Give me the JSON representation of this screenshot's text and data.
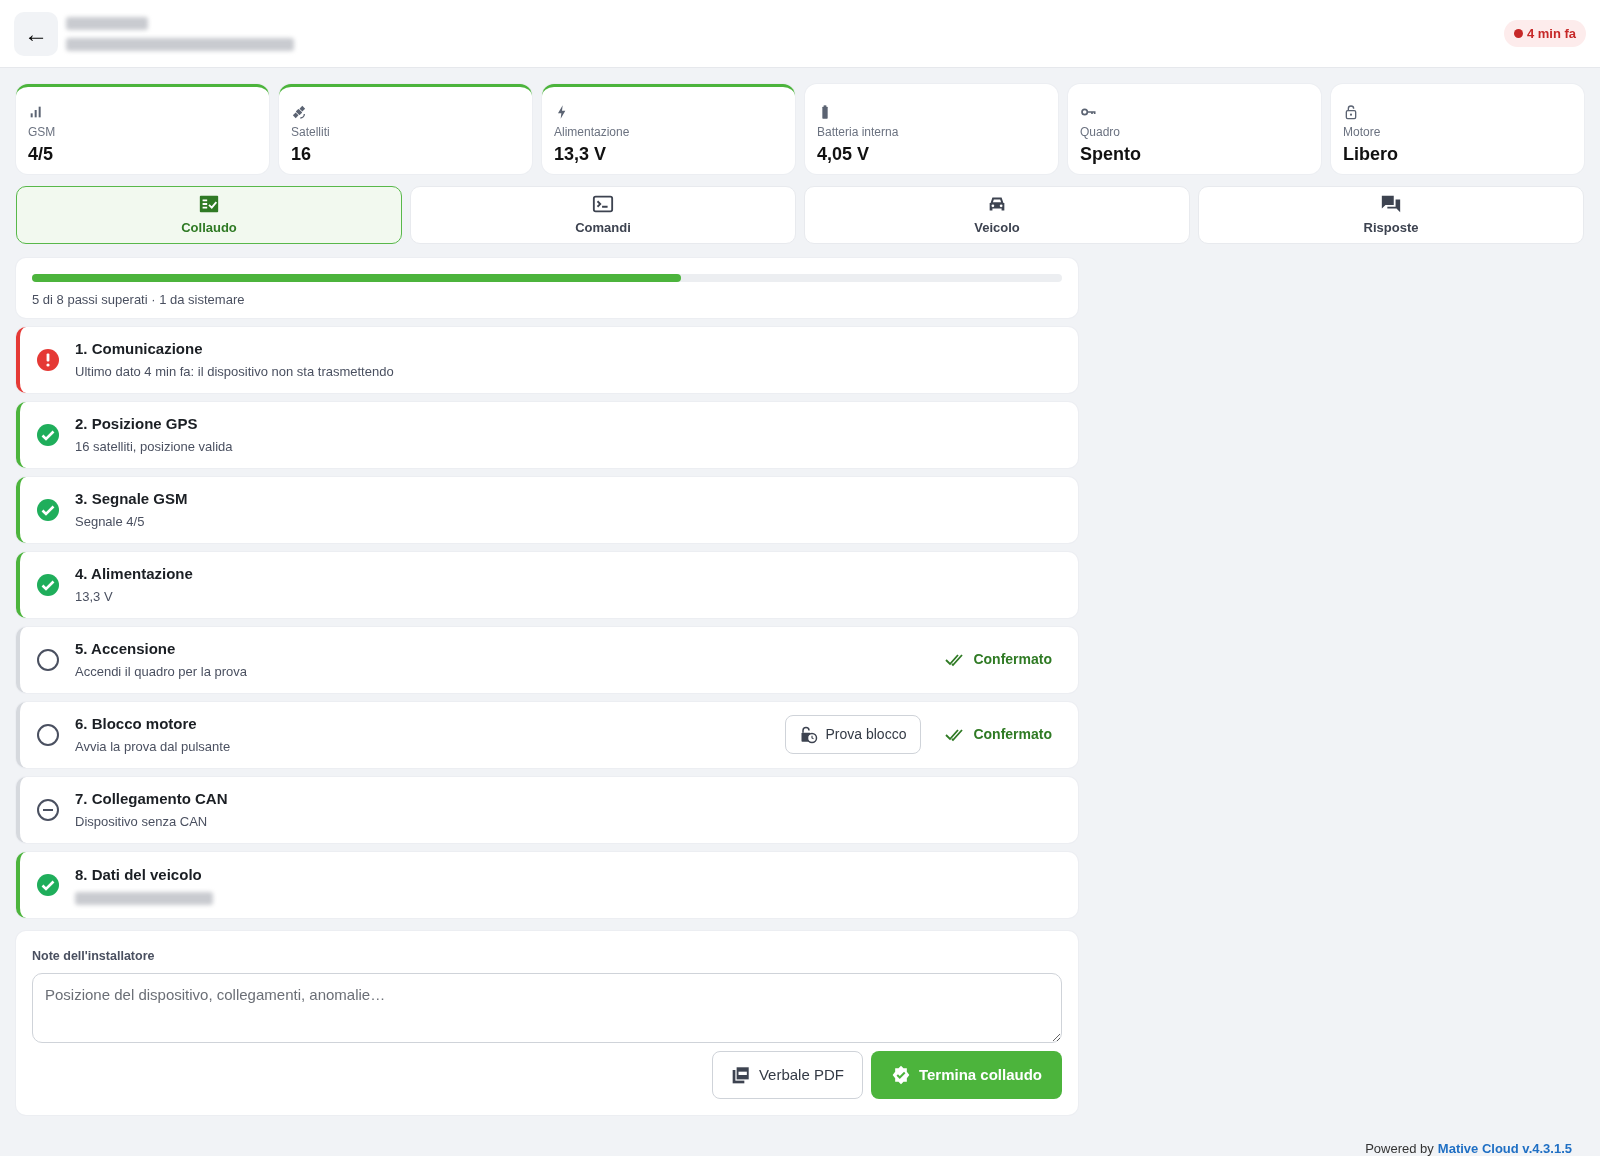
{
  "header": {
    "back_button": "←",
    "last_seen": {
      "text": "4 min fa",
      "color": "#c62828"
    }
  },
  "stats": [
    {
      "kind": "signal",
      "label": "GSM",
      "value": "4/5",
      "highlighted": true
    },
    {
      "kind": "satellite",
      "label": "Satelliti",
      "value": "16",
      "highlighted": true
    },
    {
      "kind": "bolt",
      "label": "Alimentazione",
      "value": "13,3 V",
      "highlighted": true
    },
    {
      "kind": "battery",
      "label": "Batteria interna",
      "value": "4,05 V",
      "highlighted": false
    },
    {
      "kind": "key",
      "label": "Quadro",
      "value": "Spento",
      "highlighted": false
    },
    {
      "kind": "lock",
      "label": "Motore",
      "value": "Libero",
      "highlighted": false
    }
  ],
  "tabs": [
    {
      "kind": "checklist",
      "label": "Collaudo",
      "selected": true
    },
    {
      "kind": "terminal",
      "label": "Comandi",
      "selected": false
    },
    {
      "kind": "car",
      "label": "Veicolo",
      "selected": false
    },
    {
      "kind": "chat",
      "label": "Risposte",
      "selected": false
    }
  ],
  "progress": {
    "level": 0.63,
    "summary": "5 di 8 passi superati · 1 da sistemare"
  },
  "steps": [
    {
      "title": "1. Comunicazione",
      "detail": "Ultimo dato 4 min fa: il dispositivo non sta trasmettendo",
      "kind": "error"
    },
    {
      "title": "2. Posizione GPS",
      "detail": "16 satelliti, posizione valida",
      "kind": "ok"
    },
    {
      "title": "3. Segnale GSM",
      "detail": "Segnale 4/5",
      "kind": "ok"
    },
    {
      "title": "4. Alimentazione",
      "detail": "13,3 V",
      "kind": "ok"
    },
    {
      "title": "5. Accensione",
      "detail": "Accendi il quadro per la prova",
      "kind": "pending",
      "confirmed": "Confermato"
    },
    {
      "title": "6. Blocco motore",
      "detail": "Avvia la prova dal pulsante",
      "kind": "pending",
      "action": "Prova blocco",
      "confirmed": "Confermato"
    },
    {
      "title": "7. Collegamento CAN",
      "detail": "Dispositivo senza CAN",
      "kind": "skipped"
    },
    {
      "title": "8. Dati del veicolo",
      "kind": "ok",
      "detail_redacted": true
    }
  ],
  "notes": {
    "label": "Note dell'installatore",
    "placeholder": "Posizione del dispositivo, collegamenti, anomalie…"
  },
  "actions": [
    {
      "kind": "pdf",
      "label": "Verbale PDF"
    },
    {
      "kind": "finish",
      "label": "Termina collaudo"
    }
  ],
  "footer": {
    "prefix": "Powered by",
    "brand": "Mative Cloud v.4.3.1.5"
  }
}
